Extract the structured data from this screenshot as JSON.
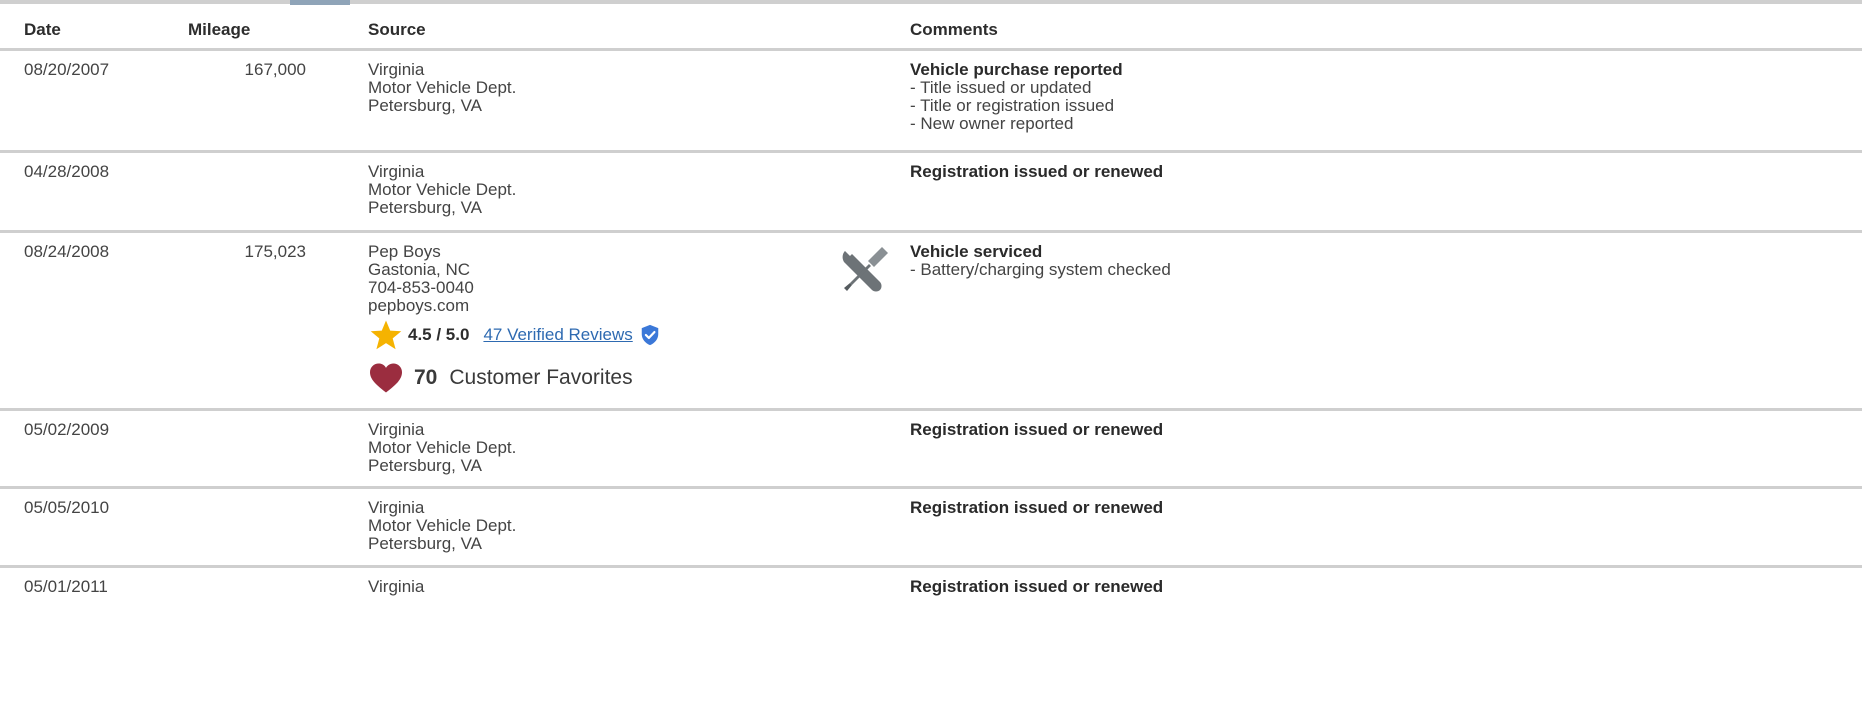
{
  "columns": {
    "date": "Date",
    "mileage": "Mileage",
    "source": "Source",
    "comments": "Comments"
  },
  "rows": [
    {
      "date": "08/20/2007",
      "mileage": "167,000",
      "source": [
        "Virginia",
        "Motor Vehicle Dept.",
        "Petersburg, VA"
      ],
      "comment_title": "Vehicle purchase reported",
      "comment_items": [
        "- Title issued or updated",
        "- Title or registration issued",
        "- New owner reported"
      ]
    },
    {
      "date": "04/28/2008",
      "mileage": "",
      "source": [
        "Virginia",
        "Motor Vehicle Dept.",
        "Petersburg, VA"
      ],
      "comment_title": "Registration issued or renewed",
      "comment_items": []
    },
    {
      "date": "08/24/2008",
      "mileage": "175,023",
      "source": [
        "Pep Boys",
        "Gastonia, NC",
        "704-853-0040",
        "pepboys.com"
      ],
      "comment_title": "Vehicle serviced",
      "comment_items": [
        "- Battery/charging system checked"
      ],
      "icon": "wrench-screwdriver-icon",
      "rating": "4.5 / 5.0",
      "reviews_link": "47 Verified Reviews",
      "favorites_count": "70",
      "favorites_label": "Customer Favorites"
    },
    {
      "date": "05/02/2009",
      "mileage": "",
      "source": [
        "Virginia",
        "Motor Vehicle Dept.",
        "Petersburg, VA"
      ],
      "comment_title": "Registration issued or renewed",
      "comment_items": []
    },
    {
      "date": "05/05/2010",
      "mileage": "",
      "source": [
        "Virginia",
        "Motor Vehicle Dept.",
        "Petersburg, VA"
      ],
      "comment_title": "Registration issued or renewed",
      "comment_items": []
    },
    {
      "date": "05/01/2011",
      "mileage": "",
      "source": [
        "Virginia"
      ],
      "comment_title": "Registration issued or renewed",
      "comment_items": []
    }
  ],
  "colors": {
    "link": "#2e6ab1",
    "star": "#f5b301",
    "heart": "#9b2d3f",
    "verified": "#3b78d8",
    "divider": "#cfcfcf",
    "icon_gray": "#6d7377"
  }
}
